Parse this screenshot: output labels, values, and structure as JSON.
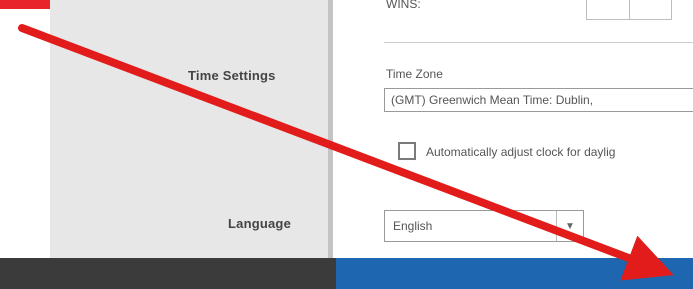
{
  "wins": {
    "label": "WINS:"
  },
  "time_settings": {
    "section_label": "Time Settings",
    "timezone_label": "Time Zone",
    "timezone_value": "(GMT) Greenwich Mean Time: Dublin,",
    "dst_checkbox_label": "Automatically adjust clock for daylig"
  },
  "language": {
    "section_label": "Language",
    "value": "English"
  },
  "colors": {
    "arrow": "#e21b1b",
    "footer_dark": "#3b3b3b",
    "footer_blue": "#1f66b0",
    "label_column_bg": "#e7e7e7"
  }
}
